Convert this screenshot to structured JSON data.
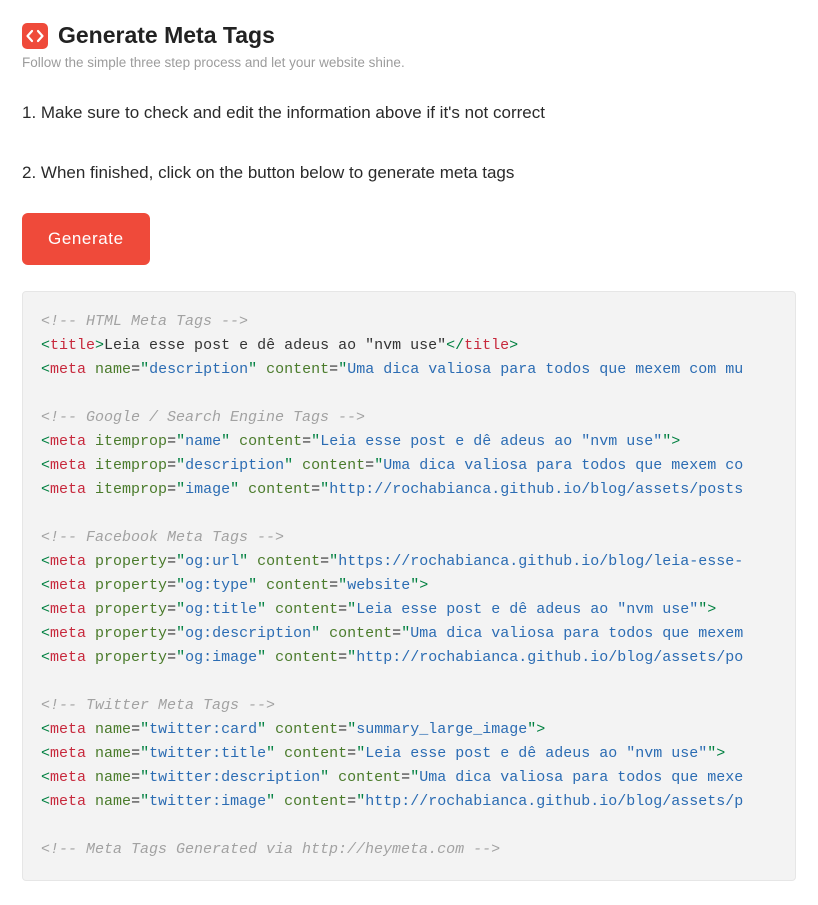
{
  "header": {
    "title": "Generate Meta Tags",
    "subtitle": "Follow the simple three step process and let your website shine."
  },
  "steps": {
    "one": "1. Make sure to check and edit the information above if it's not correct",
    "two": "2. When finished, click on the button below to generate meta tags"
  },
  "button": {
    "generate_label": "Generate"
  },
  "code": {
    "comment_html": "<!-- HTML Meta Tags -->",
    "html": {
      "title_tag_open": "title",
      "title_text": "Leia esse post e dê adeus ao \"nvm use\"",
      "meta_tag": "meta",
      "desc_attr": "name",
      "desc_name": "description",
      "content_attr": "content",
      "desc_content": "Uma dica valiosa para todos que mexem com mu"
    },
    "comment_google": "<!-- Google / Search Engine Tags -->",
    "google": {
      "itemprop_attr": "itemprop",
      "name_val": "name",
      "name_content": "Leia esse post e dê adeus ao \"nvm use\"",
      "desc_val": "description",
      "desc_content": "Uma dica valiosa para todos que mexem co",
      "image_val": "image",
      "image_content": "http://rochabianca.github.io/blog/assets/posts"
    },
    "comment_fb": "<!-- Facebook Meta Tags -->",
    "fb": {
      "property_attr": "property",
      "url_val": "og:url",
      "url_content": "https://rochabianca.github.io/blog/leia-esse-",
      "type_val": "og:type",
      "type_content": "website",
      "title_val": "og:title",
      "title_content": "Leia esse post e dê adeus ao \"nvm use\"",
      "desc_val": "og:description",
      "desc_content": "Uma dica valiosa para todos que mexem",
      "image_val": "og:image",
      "image_content": "http://rochabianca.github.io/blog/assets/po"
    },
    "comment_tw": "<!-- Twitter Meta Tags -->",
    "tw": {
      "name_attr": "name",
      "card_val": "twitter:card",
      "card_content": "summary_large_image",
      "title_val": "twitter:title",
      "title_content": "Leia esse post e dê adeus ao \"nvm use\"",
      "desc_val": "twitter:description",
      "desc_content": "Uma dica valiosa para todos que mexe",
      "image_val": "twitter:image",
      "image_content": "http://rochabianca.github.io/blog/assets/p"
    },
    "comment_gen": "<!-- Meta Tags Generated via http://heymeta.com -->"
  }
}
